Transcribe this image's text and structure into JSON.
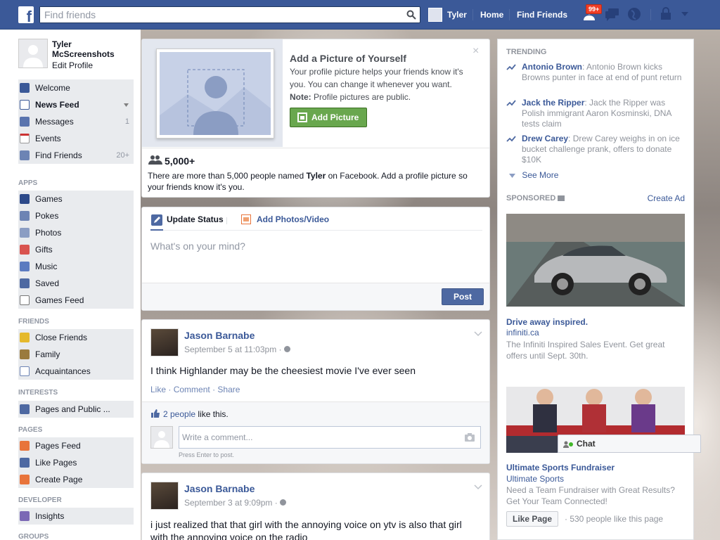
{
  "header": {
    "logo": "f",
    "search_placeholder": "Find friends",
    "user_name": "Tyler",
    "home": "Home",
    "find_friends": "Find Friends",
    "notif_badge": "99+",
    "colors": {
      "brand": "#3b5998",
      "badge": "#f03d25"
    }
  },
  "profile": {
    "name": "Tyler McScreenshots",
    "edit": "Edit Profile"
  },
  "nav": {
    "main": [
      {
        "label": "Welcome",
        "icon": "facebook-icon",
        "count": ""
      },
      {
        "label": "News Feed",
        "icon": "news-feed-icon",
        "count": ""
      },
      {
        "label": "Messages",
        "icon": "messages-icon",
        "count": "1"
      },
      {
        "label": "Events",
        "icon": "calendar-icon",
        "count": ""
      },
      {
        "label": "Find Friends",
        "icon": "find-friends-icon",
        "count": "20+"
      }
    ],
    "apps_heading": "APPS",
    "apps": [
      {
        "label": "Games",
        "icon": "games-icon"
      },
      {
        "label": "Pokes",
        "icon": "pokes-icon"
      },
      {
        "label": "Photos",
        "icon": "photos-icon"
      },
      {
        "label": "Gifts",
        "icon": "gift-icon"
      },
      {
        "label": "Music",
        "icon": "music-icon"
      },
      {
        "label": "Saved",
        "icon": "bookmark-icon"
      },
      {
        "label": "Games Feed",
        "icon": "gamepad-icon"
      }
    ],
    "friends_heading": "FRIENDS",
    "friends": [
      {
        "label": "Close Friends",
        "icon": "star-icon"
      },
      {
        "label": "Family",
        "icon": "house-icon"
      },
      {
        "label": "Acquaintances",
        "icon": "list-icon"
      }
    ],
    "interests_heading": "INTERESTS",
    "interests": [
      {
        "label": "Pages and Public ...",
        "icon": "rss-icon"
      }
    ],
    "pages_heading": "PAGES",
    "pages": [
      {
        "label": "Pages Feed",
        "icon": "pages-feed-icon"
      },
      {
        "label": "Like Pages",
        "icon": "thumbs-up-icon"
      },
      {
        "label": "Create Page",
        "icon": "plus-icon"
      }
    ],
    "developer_heading": "DEVELOPER",
    "developer": [
      {
        "label": "Insights",
        "icon": "chart-icon"
      }
    ],
    "groups_heading": "GROUPS"
  },
  "add_picture": {
    "title": "Add a Picture of Yourself",
    "body": "Your profile picture helps your friends know it's you. You can change it whenever you want.",
    "note_label": "Note:",
    "note_text": " Profile pictures are public.",
    "button": "Add Picture",
    "count": "5,000+",
    "people_prefix": "There are more than 5,000 people named ",
    "people_name": "Tyler",
    "people_suffix": " on Facebook. Add a profile picture so your friends know it's you."
  },
  "composer": {
    "tab_status": "Update Status",
    "tab_photo": "Add Photos/Video",
    "placeholder": "What's on your mind?",
    "post": "Post"
  },
  "posts": [
    {
      "author": "Jason Barnabe",
      "time": "September 5 at 11:03pm ·",
      "text": "I think Highlander may be the cheesiest movie I've ever seen",
      "actions": {
        "like": "Like",
        "comment": "Comment",
        "share": "Share",
        "sep": "·"
      },
      "likes_link": "2 people",
      "likes_suffix": " like this.",
      "comment_placeholder": "Write a comment...",
      "enter_hint": "Press Enter to post."
    },
    {
      "author": "Jason Barnabe",
      "time": "September 3 at 9:09pm ·",
      "text": "i just realized that that girl with the annoying voice on ytv is also that girl with the annoying voice on the radio"
    }
  ],
  "trending": {
    "heading": "TRENDING",
    "items": [
      {
        "title": "Antonio Brown",
        "desc": ": Antonio Brown kicks Browns punter in face at end of punt return"
      },
      {
        "title": "Jack the Ripper",
        "desc": ": Jack the Ripper was Polish immigrant Aaron Kosminski, DNA tests claim"
      },
      {
        "title": "Drew Carey",
        "desc": ": Drew Carey weighs in on ice bucket challenge prank, offers to donate $10K"
      }
    ],
    "see_more": "See More"
  },
  "sponsored": {
    "heading": "SPONSORED",
    "create_ad": "Create Ad",
    "ads": [
      {
        "title": "Drive away inspired.",
        "url": "infiniti.ca",
        "desc": "The Infiniti Inspired Sales Event. Get great offers until Sept. 30th."
      },
      {
        "title": "Ultimate Sports Fundraiser",
        "url": "Ultimate Sports",
        "desc": "Need a Team Fundraiser with Great Results? Get Your Team Connected!",
        "like_btn": "Like Page",
        "likes": "· 530 people like this page"
      }
    ]
  },
  "chat": {
    "label": "Chat"
  }
}
